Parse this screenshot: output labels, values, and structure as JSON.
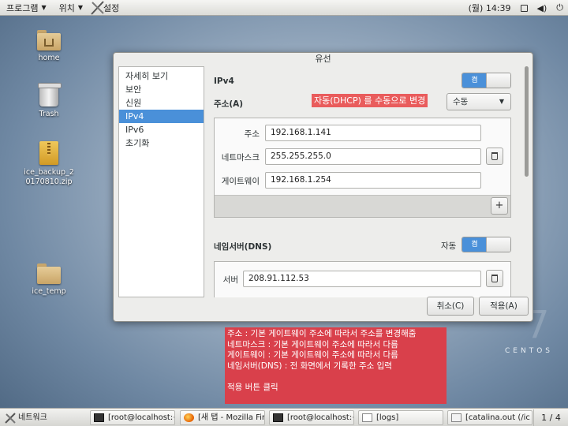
{
  "topbar": {
    "menus": [
      "프로그램",
      "위치",
      "설정"
    ],
    "clock": "(월) 14:39"
  },
  "desktop": {
    "icons": [
      "home",
      "Trash",
      "ice_backup_20170810.zip",
      "ice_temp"
    ]
  },
  "dialog": {
    "title": "유선",
    "sidebar": [
      "자세히 보기",
      "보안",
      "신원",
      "IPv4",
      "IPv6",
      "초기화"
    ],
    "selected_sidebar": "IPv4",
    "ipv4_label": "IPv4",
    "toggle_on_label": "켬",
    "address_section_label": "주소(A)",
    "method_value": "수동",
    "rows": [
      {
        "label": "주소",
        "value": "192.168.1.141"
      },
      {
        "label": "네트마스크",
        "value": "255.255.255.0"
      },
      {
        "label": "게이트웨이",
        "value": "192.168.1.254"
      }
    ],
    "add_button": "+",
    "dns_label": "네임서버(DNS)",
    "dns_auto_label": "자동",
    "dns_toggle_label": "켬",
    "server_label": "서버",
    "server_value": "208.91.112.53",
    "cancel_button": "취소(C)",
    "apply_button": "적용(A)"
  },
  "annotations": {
    "top_note": "자동(DHCP) 를 수동으로 변경",
    "box_lines": [
      "주소 : 기본 게이트웨이 주소에 따라서 주소를 변경해줌",
      "네트마스크 : 기본 게이트웨이 주소에 따라서 다름",
      "게이트웨이 : 기본 게이트웨이 주소에 따라서 다름",
      "네임서버(DNS) : 전 화면에서 기록한 주소 입력",
      "",
      "적용 버튼 클릭"
    ]
  },
  "branding": "CENTOS",
  "taskbar": {
    "network_label": "네트워크",
    "tasks": [
      "[root@localhost:~",
      "[새 탭 - Mozilla Fir",
      "[root@localhost:~",
      "[logs]",
      "[catalina.out (/ic"
    ],
    "pager": "1 / 4"
  }
}
